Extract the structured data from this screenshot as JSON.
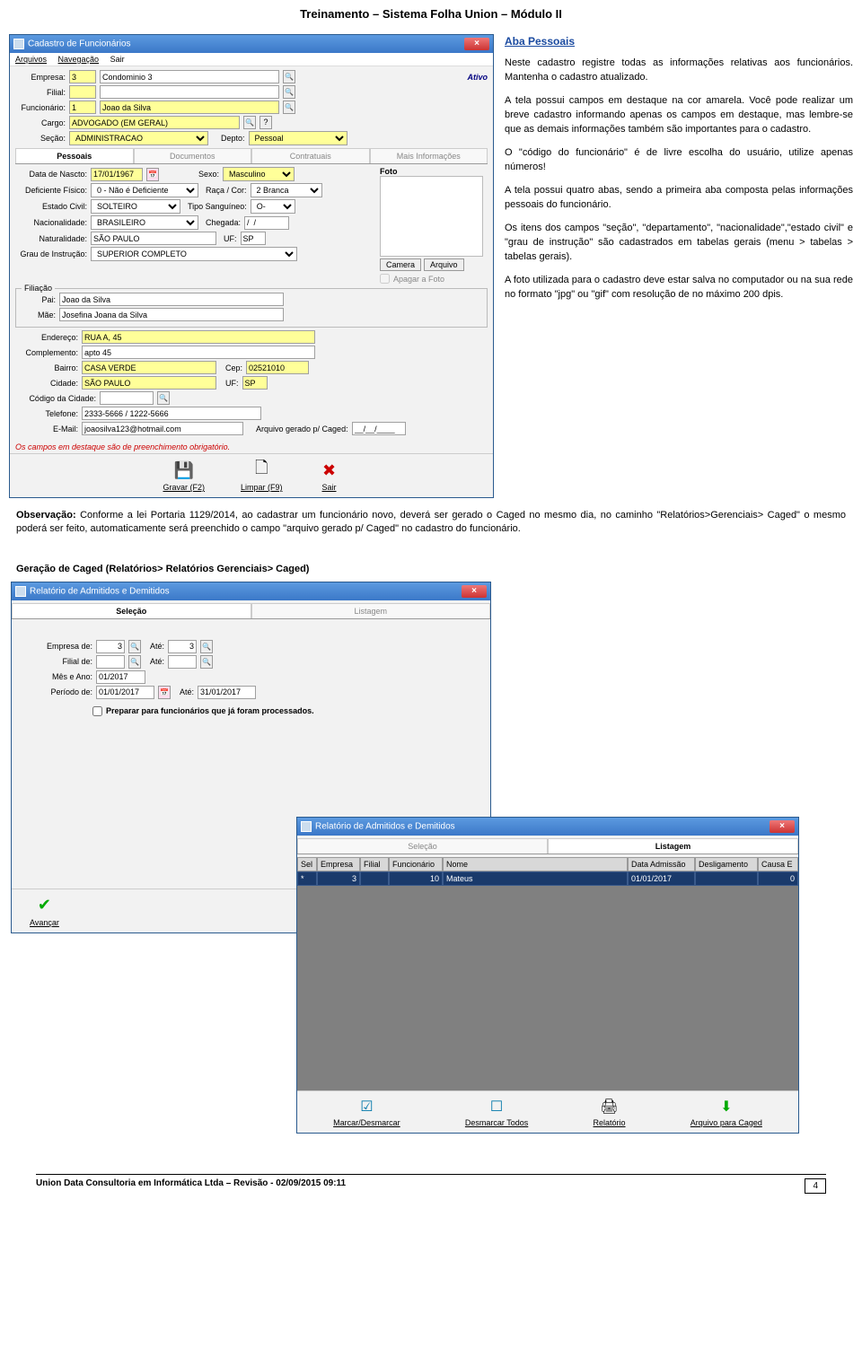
{
  "doc": {
    "header": "Treinamento – Sistema Folha Union – Módulo II",
    "section_title": "Aba Pessoais",
    "paragraphs": [
      "Neste cadastro registre todas as informações relativas aos funcionários. Mantenha o cadastro atualizado.",
      "A tela possui campos em destaque na cor amarela. Você pode realizar um breve cadastro informando apenas os campos em destaque, mas lembre-se que as demais informações também são importantes para o cadastro.",
      "O \"código do funcionário\" é de livre escolha do usuário, utilize apenas números!",
      "A tela possui quatro abas, sendo a primeira aba composta pelas informações pessoais do funcionário.",
      "Os itens dos campos \"seção\", \"departamento\", \"nacionalidade\",\"estado civil\" e \"grau de instrução\" são cadastrados em tabelas gerais (menu > tabelas > tabelas gerais).",
      "A foto utilizada para o cadastro deve estar salva no computador ou na sua rede no formato \"jpg\" ou \"gif\" com resolução de no máximo 200 dpis."
    ],
    "obs_label": "Observação:",
    "obs_text": " Conforme a lei Portaria 1129/2014, ao cadastrar um funcionário novo, deverá ser gerado o Caged no mesmo dia, no caminho \"Relatórios>Gerenciais> Caged\" o mesmo poderá ser feito, automaticamente será preenchido o campo \"arquivo gerado p/ Caged\" no cadastro do funcionário.",
    "sub_heading": "Geração de Caged (Relatórios> Relatórios Gerenciais> Caged)",
    "footer_text": "Union Data Consultoria em Informática Ltda – Revisão - 02/09/2015 09:11",
    "page_number": "4"
  },
  "win1": {
    "title": "Cadastro de Funcionários",
    "menus": [
      "Arquivos",
      "Navegação",
      "Sair"
    ],
    "labels": {
      "empresa": "Empresa:",
      "filial": "Filial:",
      "funcionario": "Funcionário:",
      "cargo": "Cargo:",
      "secao": "Seção:",
      "depto": "Depto:",
      "ativo": "Ativo",
      "data_nascto": "Data de Nascto:",
      "sexo": "Sexo:",
      "deficiente": "Deficiente Físico:",
      "raca": "Raça / Cor:",
      "estado_civil": "Estado Civil:",
      "tipo_sang": "Tipo Sanguíneo:",
      "nacionalidade": "Nacionalidade:",
      "chegada": "Chegada:",
      "naturalidade": "Naturalidade:",
      "uf": "UF:",
      "grau": "Grau de Instrução:",
      "filiacao": "Filiação",
      "pai": "Pai:",
      "mae": "Mãe:",
      "endereco": "Endereço:",
      "complemento": "Complemento:",
      "bairro": "Bairro:",
      "cep": "Cep:",
      "cidade": "Cidade:",
      "codigo_cidade": "Código da Cidade:",
      "telefone": "Telefone:",
      "email": "E-Mail:",
      "foto": "Foto",
      "camera": "Camera",
      "arquivo": "Arquivo",
      "apagar_foto": "Apagar a Foto",
      "arquivo_caged": "Arquivo gerado p/ Caged:"
    },
    "values": {
      "empresa_cod": "3",
      "empresa_nome": "Condominio 3",
      "filial": "",
      "funcionario_cod": "1",
      "funcionario_nome": "Joao da Silva",
      "cargo": "ADVOGADO (EM GERAL)",
      "secao": "ADMINISTRACAO",
      "depto": "Pessoal",
      "data_nascto": "17/01/1967",
      "sexo": "Masculino",
      "deficiente": "0 - Não é Deficiente",
      "raca": "2 Branca",
      "estado_civil": "SOLTEIRO",
      "tipo_sang": "O-",
      "nacionalidade": "BRASILEIRO",
      "chegada": "/  /",
      "naturalidade": "SÃO PAULO",
      "uf": "SP",
      "grau": "SUPERIOR COMPLETO",
      "pai": "Joao da Silva",
      "mae": "Josefina Joana da Silva",
      "endereco": "RUA A, 45",
      "complemento": "apto 45",
      "bairro": "CASA VERDE",
      "cep": "02521010",
      "cidade": "SÃO PAULO",
      "uf2": "SP",
      "codigo_cidade": "",
      "telefone": "2333-5666 / 1222-5666",
      "email": "joaosilva123@hotmail.com",
      "arquivo_caged": "__/__/____"
    },
    "tabs": [
      "Pessoais",
      "Documentos",
      "Contratuais",
      "Mais Informações"
    ],
    "note": "Os campos em destaque são de preenchimento obrigatório.",
    "toolbar": {
      "gravar": "Gravar (F2)",
      "limpar": "Limpar (F9)",
      "sair": "Sair"
    }
  },
  "win2": {
    "title": "Relatório de Admitidos e Demitidos",
    "tabs": [
      "Seleção",
      "Listagem"
    ],
    "labels": {
      "empresa_de": "Empresa de:",
      "ate": "Até:",
      "filial_de": "Filial de:",
      "mes_ano": "Mês e Ano:",
      "periodo_de": "Período de:",
      "check": "Preparar para funcionários que já foram processados."
    },
    "values": {
      "empresa_de": "3",
      "empresa_ate": "3",
      "filial_de": "",
      "filial_ate": "",
      "mes_ano": "01/2017",
      "periodo_de": "01/01/2017",
      "periodo_ate": "31/01/2017"
    },
    "toolbar": {
      "avancar": "Avançar"
    }
  },
  "win3": {
    "title": "Relatório de Admitidos e Demitidos",
    "tabs": [
      "Seleção",
      "Listagem"
    ],
    "grid_headers": [
      "Sel",
      "Empresa",
      "Filial",
      "Funcionário",
      "Nome",
      "Data Admissão",
      "Desligamento",
      "Causa E"
    ],
    "grid_row": [
      "*",
      "3",
      "",
      "10",
      "Mateus",
      "01/01/2017",
      "",
      "0"
    ],
    "toolbar": {
      "marcar": "Marcar/Desmarcar",
      "desmarcar_todos": "Desmarcar Todos",
      "relatorio": "Relatório",
      "arquivo_caged": "Arquivo para Caged"
    }
  }
}
